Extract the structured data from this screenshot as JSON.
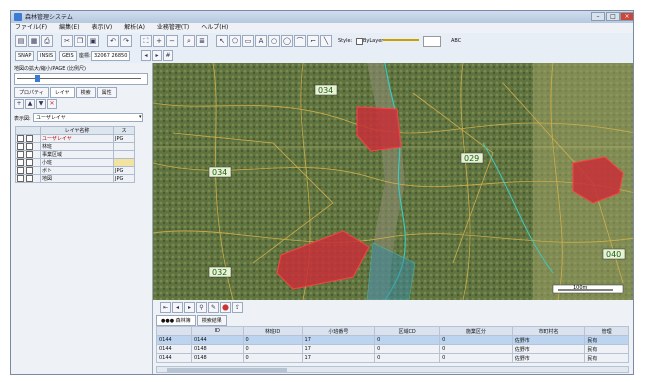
{
  "window": {
    "title": "森林管理システム"
  },
  "menu": [
    "ファイル(F)",
    "編集(E)",
    "表示(V)",
    "解析(A)",
    "业務管理(T)",
    "ヘルプ(H)"
  ],
  "toolbar2": {
    "snap_label": "SNAP",
    "buttons": [
      "SNAP",
      "INSIS",
      "GEIS",
      "座標:"
    ],
    "coords": "32067 26850"
  },
  "style": {
    "label": "Style:",
    "byline": "ByLayer",
    "abc": "ABC"
  },
  "left_panel": {
    "scale_label": "地図の拡大/縮小/PAGE (比例尺)",
    "tabs": [
      "プロパティ",
      "レイヤ",
      "検索",
      "属性"
    ],
    "layer_select_label": "表示図:",
    "layer_select_value": "ユーザレイヤ",
    "layer_header": [
      "レイヤ名称",
      "ス"
    ],
    "layers": [
      {
        "name": "ユーザレイヤ",
        "tag": "JPG"
      },
      {
        "name": "林班",
        "tag": ""
      },
      {
        "name": "事業区域",
        "tag": ""
      },
      {
        "name": "小班",
        "tag": ""
      },
      {
        "name": "ボト",
        "tag": "JPG"
      },
      {
        "name": "地図",
        "tag": "JPG"
      }
    ]
  },
  "map": {
    "labels": [
      "034",
      "034",
      "032",
      "029",
      "040"
    ],
    "scale_text": "100m",
    "highlight_color": "#d0303a"
  },
  "bottom": {
    "tabs": [
      "●●● 森林簿",
      "検索結果"
    ],
    "columns": [
      "ID",
      "林班ID",
      "小班番号",
      "区域CD",
      "施業区分",
      "市町村名",
      "管理"
    ],
    "rows": [
      [
        "0144",
        "0144",
        "0",
        "17",
        "0",
        "0",
        "佐野市",
        "民有"
      ],
      [
        "0144",
        "0148",
        "0",
        "17",
        "0",
        "0",
        "佐野市",
        "民有"
      ],
      [
        "0144",
        "0148",
        "0",
        "17",
        "0",
        "0",
        "佐野市",
        "民有"
      ]
    ]
  }
}
